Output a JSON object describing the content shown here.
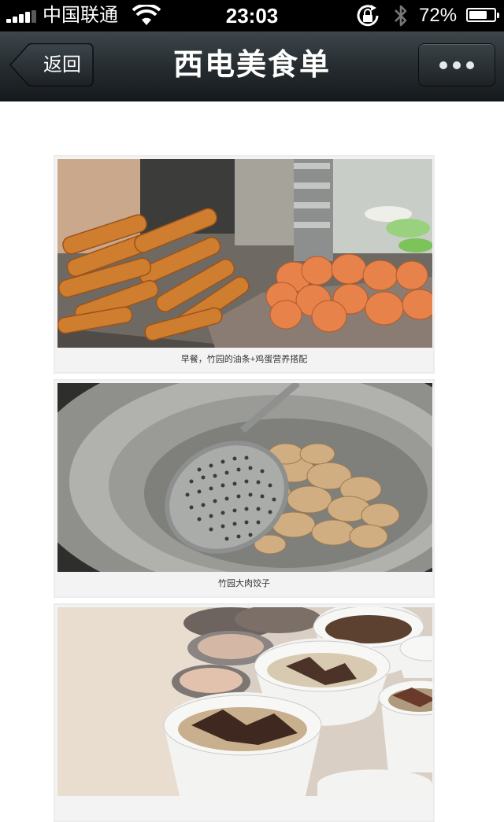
{
  "status_bar": {
    "carrier": "中国联通",
    "time": "23:03",
    "battery_percent": "72%",
    "battery_level": 0.72,
    "icons": [
      "signal-icon",
      "wifi-icon",
      "rotation-lock-icon",
      "bluetooth-icon",
      "battery-icon"
    ]
  },
  "nav_bar": {
    "back_label": "返回",
    "title": "西电美食单",
    "more_icon": "more-dots-icon"
  },
  "posts": [
    {
      "caption": "早餐，竹园的油条+鸡蛋营养搭配",
      "image_subject": "fried dough sticks and eggs"
    },
    {
      "caption": "竹园大肉饺子",
      "image_subject": "dumplings with ladle"
    },
    {
      "caption": "",
      "image_subject": "bowls of noodles with toppings"
    }
  ],
  "colors": {
    "nav_dark": "#1d2225",
    "status_bg": "#000000",
    "card_bg": "#f3f3f3"
  }
}
